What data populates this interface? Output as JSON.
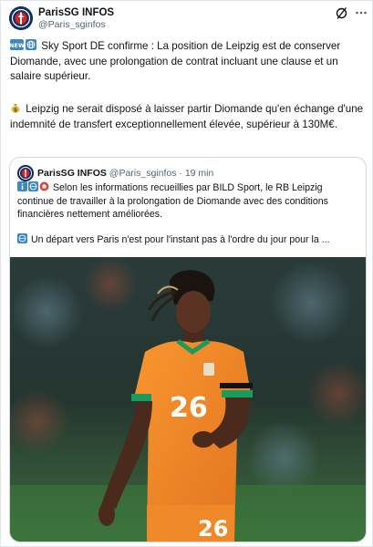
{
  "author": {
    "name": "ParisSG INFOS",
    "handle": "@Paris_sginfos"
  },
  "tweet": {
    "p1": "Sky Sport DE confirme : La position de Leipzig est de conserver Diomande, avec une prolongation de contrat incluant une clause et un salaire supérieur.",
    "p2": "Leipzig ne serait disposé à laisser partir Diomande qu'en échange d'une indemnité de transfert exceptionnellement élevée, supérieur à 130M€."
  },
  "quoted": {
    "name": "ParisSG INFOS",
    "handle": "@Paris_sginfos",
    "separator": "·",
    "time": "19 min",
    "p1": "Selon les informations recueillies par BILD Sport, le RB Leipzig continue de travailler à la prolongation de Diomande avec des conditions financières nettement améliorées.",
    "p2": "Un départ vers Paris n'est pour l'instant pas à l'ordre du jour pour la ..."
  },
  "icons": {
    "grok": "grok-icon",
    "more": "more-options-icon",
    "new_badge": "new-badge-icon",
    "globe": "globe-icon",
    "money_bag": "money-bag-icon",
    "info": "info-icon",
    "alert": "alert-icon"
  },
  "photo": {
    "shirt_number": "26"
  },
  "colors": {
    "text": "#0f1419",
    "muted": "#536471",
    "border": "#cfd9de",
    "psg_navy": "#11305f",
    "jersey_orange": "#f0852a",
    "jersey_trim": "#1a9a5c"
  }
}
